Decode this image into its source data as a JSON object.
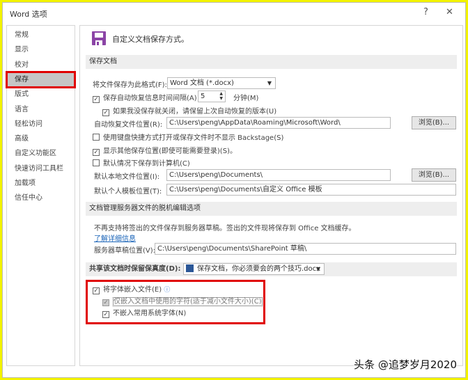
{
  "window": {
    "title": "Word 选项",
    "help": "?",
    "close": "✕"
  },
  "sidebar": {
    "items": [
      "常规",
      "显示",
      "校对",
      "保存",
      "版式",
      "语言",
      "轻松访问",
      "高级",
      "自定义功能区",
      "快速访问工具栏",
      "加载项",
      "信任中心"
    ],
    "selected": 3
  },
  "header": {
    "title": "自定义文档保存方式。"
  },
  "save": {
    "section": "保存文档",
    "format_label": "将文件保存为此格式(F):",
    "format_value": "Word 文档 (*.docx)",
    "autosave_label": "保存自动恢复信息时间间隔(A)",
    "autosave_value": "5",
    "minutes": "分钟(M)",
    "keep_last": "如果我没保存就关闭，请保留上次自动恢复的版本(U)",
    "recovery_label": "自动恢复文件位置(R):",
    "recovery_value": "C:\\Users\\peng\\AppData\\Roaming\\Microsoft\\Word\\",
    "browse": "浏览(B)...",
    "backstage": "使用键盘快捷方式打开或保存文件时不显示 Backstage(S)",
    "show_other": "显示其他保存位置(即使可能需要登录)(S)。",
    "save_computer": "默认情况下保存到计算机(C)",
    "local_label": "默认本地文件位置(I):",
    "local_value": "C:\\Users\\peng\\Documents\\",
    "template_label": "默认个人模板位置(T):",
    "template_value": "C:\\Users\\peng\\Documents\\自定义 Office 模板"
  },
  "offline": {
    "section": "文档管理服务器文件的脱机编辑选项",
    "note": "不再支持将签出的文件保存到服务器草稿。签出的文件现将保存到 Office 文档缓存。",
    "link": "了解详细信息",
    "drafts_label": "服务器草稿位置(V):",
    "drafts_value": "C:\\Users\\peng\\Documents\\SharePoint 草稿\\"
  },
  "fidelity": {
    "section": "共享该文档时保留保真度(D):",
    "document": "保存文档，你必须要会的两个技巧.docx",
    "embed": "将字体嵌入文件(E)",
    "only_used": "仅嵌入文档中使用的字符(适于减小文件大小)(C)",
    "no_common": "不嵌入常用系统字体(N)"
  },
  "watermark": "头条 @追梦岁月2020"
}
